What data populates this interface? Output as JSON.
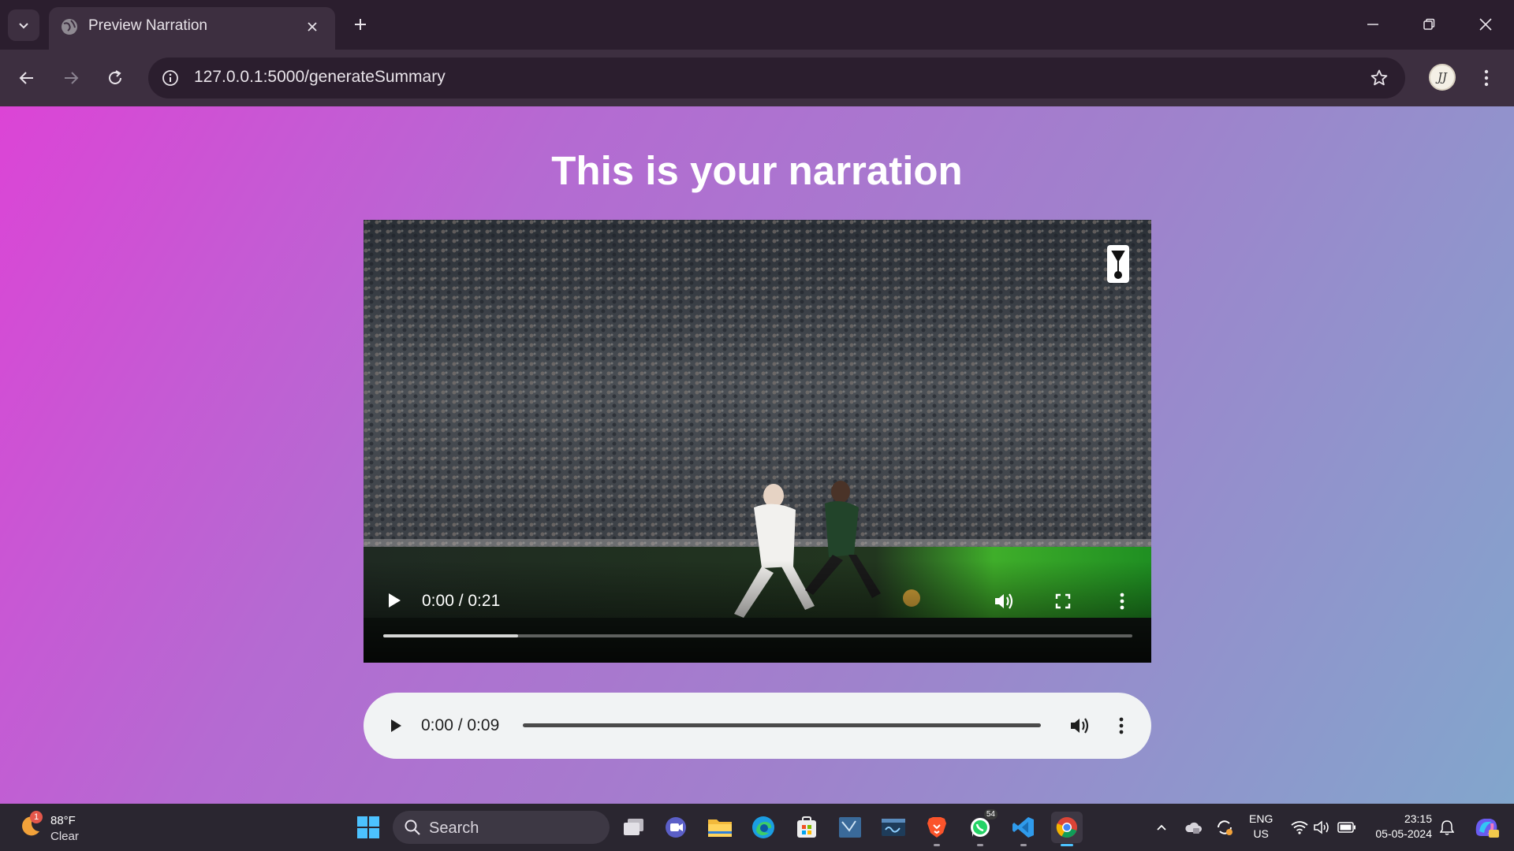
{
  "browser": {
    "tab": {
      "title": "Preview Narration"
    },
    "address_bar": {
      "url": "127.0.0.1:5000/generateSummary"
    }
  },
  "page": {
    "title": "This is your narration",
    "video_player": {
      "time_display": "0:00 / 0:21",
      "buffered_fraction": 0.18
    },
    "audio_player": {
      "time_display": "0:00 / 0:09"
    }
  },
  "taskbar": {
    "weather": {
      "temperature": "88°F",
      "condition": "Clear",
      "badge": "1"
    },
    "search_label": "Search",
    "apps": [
      "file-explorer-window",
      "meet",
      "file-explorer",
      "edge",
      "store",
      "app-window",
      "mysql-workbench",
      "brave",
      "whatsapp",
      "vscode",
      "chrome"
    ],
    "whatsapp_badge": "54",
    "language": {
      "line1": "ENG",
      "line2": "US"
    },
    "clock": {
      "time": "23:15",
      "date": "05-05-2024"
    }
  },
  "colors": {
    "gradient_start": "#dc44d6",
    "gradient_end": "#82a6cc",
    "chrome_dark": "#2b1e2e",
    "chrome_toolbar": "#3d2f40"
  }
}
